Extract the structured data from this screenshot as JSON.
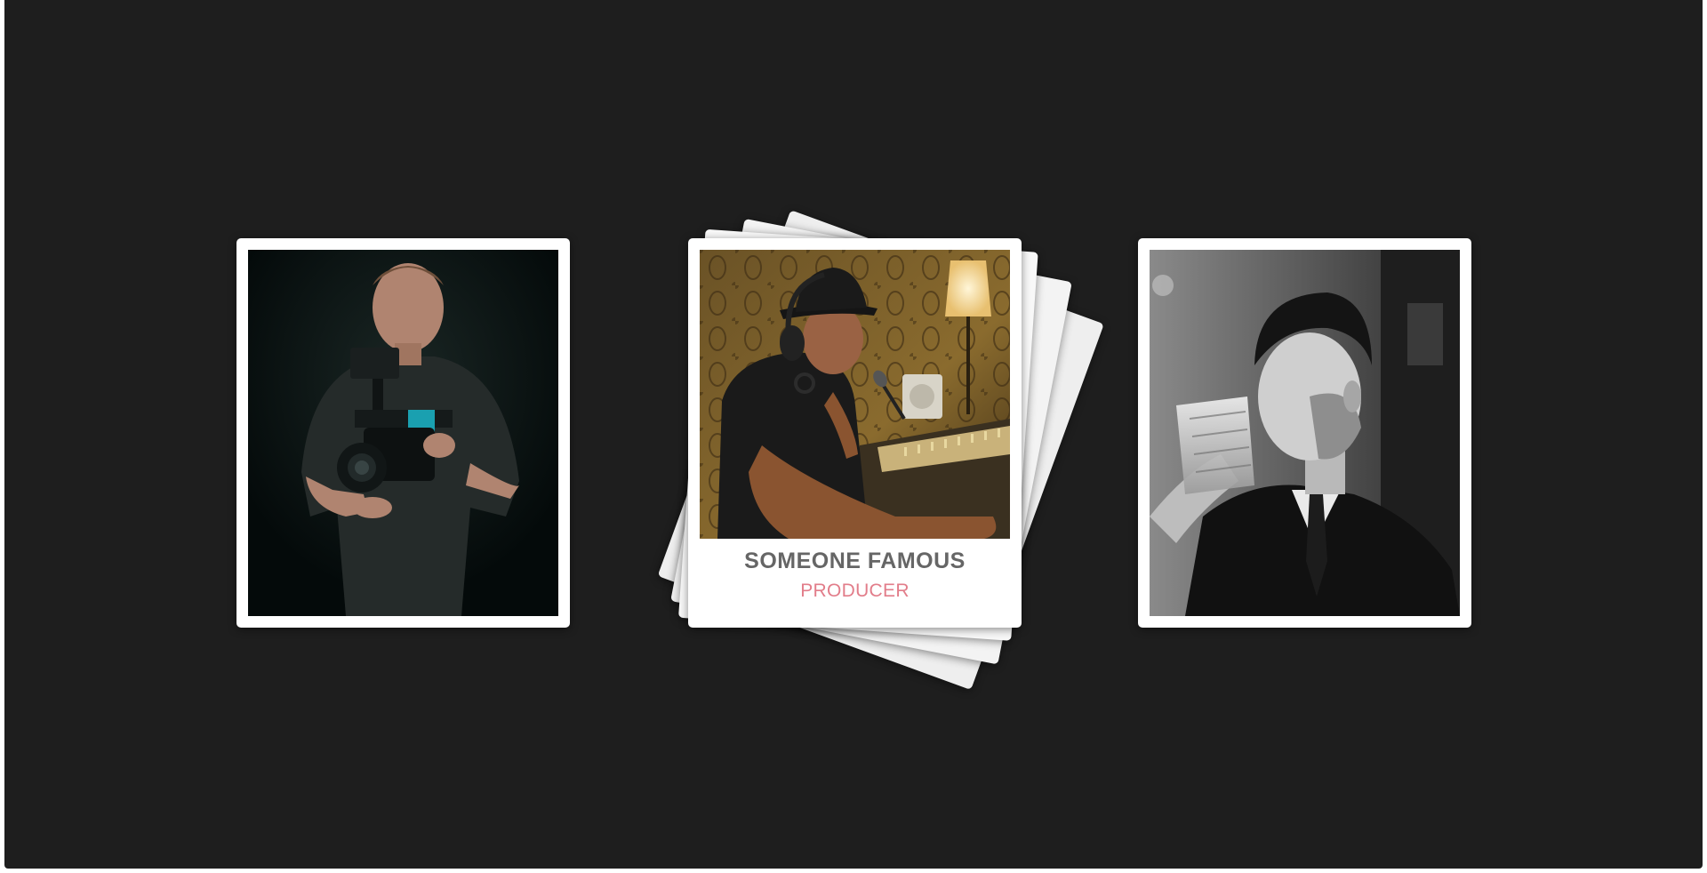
{
  "gallery": {
    "cards": [
      {
        "id": "videographer",
        "icon": "person-with-camera-rig-photo"
      },
      {
        "id": "producer",
        "icon": "person-at-mixing-console-photo",
        "name": "SOMEONE FAMOUS",
        "role": "PRODUCER"
      },
      {
        "id": "drinker",
        "icon": "person-drinking-whiskey-photo"
      }
    ],
    "colors": {
      "background": "#1e1e1e",
      "card": "#ffffff",
      "name_text": "#666666",
      "role_text": "#e27d8a"
    }
  }
}
